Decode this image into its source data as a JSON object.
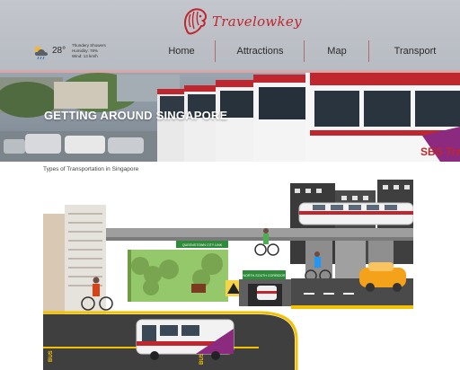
{
  "header": {
    "logo_text": "Travelowkey",
    "weather": {
      "icon": "cloud-sun-rain-icon",
      "temperature": "28°",
      "condition": "Thundery Showers",
      "humidity": "Humidity: 78%",
      "wind": "Wind: 13 km/h"
    },
    "nav": [
      "Home",
      "Attractions",
      "Map",
      "Transport"
    ]
  },
  "hero": {
    "title": "GETTING AROUND SINGAPORE"
  },
  "content": {
    "section_label": "Types of Transportation in Singapore",
    "illustration": {
      "signs": {
        "sign_1": "QUEENSTOWN CITY LINK",
        "sign_2": "NORTH-SOUTH CORRIDOR"
      },
      "road_markings": [
        "BUS",
        "BUS"
      ],
      "bus_brand": "SBS Transit"
    }
  },
  "colors": {
    "brand_red": "#c0262d",
    "header_bg": "#bfc2c8",
    "nav_separator": "#b56a6a"
  }
}
